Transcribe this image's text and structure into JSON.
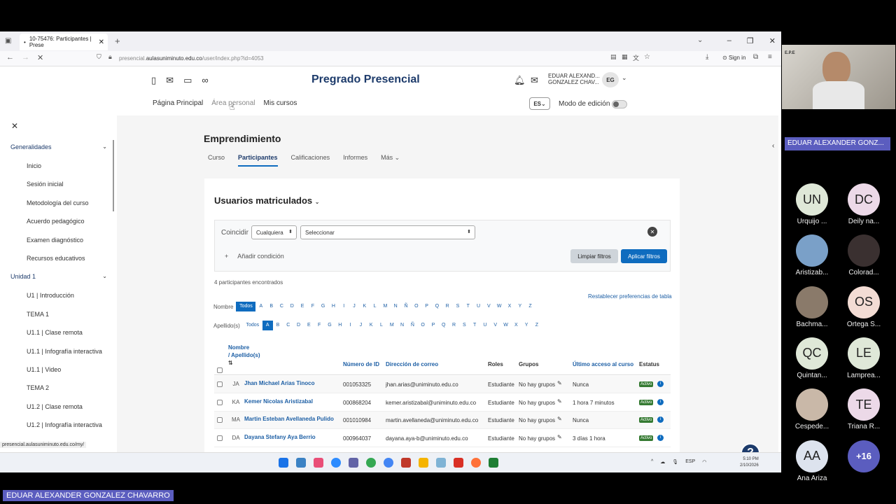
{
  "browser": {
    "tab_title": "10-75476: Participantes | Prese",
    "url_prefix": "presencial.",
    "url_domain": "aulasuniminuto.edu.co",
    "url_path": "/user/index.php?id=4053",
    "sign_in": "Sign in"
  },
  "site": {
    "brand": "Pregrado Presencial",
    "user_name_line1": "EDUAR ALEXAND...",
    "user_name_line2": "GONZALEZ CHAV...",
    "user_initials": "EG",
    "nav": [
      "Página Principal",
      "Área personal",
      "Mis cursos"
    ],
    "lang": "ES",
    "edit_mode": "Modo de edición"
  },
  "drawer": {
    "sections": [
      {
        "label": "Generalidades",
        "items": [
          "Inicio",
          "Sesión inicial",
          "Metodología del curso",
          "Acuerdo pedagógico",
          "Examen diagnóstico",
          "Recursos educativos"
        ]
      },
      {
        "label": "Unidad 1",
        "items": [
          "U1 | Introducción",
          "TEMA 1",
          "U1.1 | Clase remota",
          "U1.1 | Infografía interactiva",
          "U1.1 | Video",
          "TEMA 2",
          "U1.2 | Clase remota",
          "U1.2 | Infografía interactiva"
        ]
      }
    ]
  },
  "course": {
    "title": "Emprendimiento",
    "tabs": [
      "Curso",
      "Participantes",
      "Calificaciones",
      "Informes",
      "Más"
    ]
  },
  "participants": {
    "heading": "Usuarios matriculados",
    "filter_label": "Coincidir",
    "match_value": "Cualquiera",
    "select_value": "Seleccionar",
    "add_condition": "Añadir condición",
    "clear_filters": "Limpiar filtros",
    "apply_filters": "Aplicar filtros",
    "found": "4 participantes encontrados",
    "reset_prefs": "Restablecer preferencias de tabla",
    "first_name_label": "Nombre",
    "last_name_label": "Apellido(s)",
    "all_label": "Todos",
    "letters": [
      "A",
      "B",
      "C",
      "D",
      "E",
      "F",
      "G",
      "H",
      "I",
      "J",
      "K",
      "L",
      "M",
      "N",
      "Ñ",
      "O",
      "P",
      "Q",
      "R",
      "S",
      "T",
      "U",
      "V",
      "W",
      "X",
      "Y",
      "Z"
    ],
    "columns": {
      "name": "Nombre",
      "surname": "/ Apellido(s)",
      "id": "Número de ID",
      "email": "Dirección de correo",
      "roles": "Roles",
      "groups": "Grupos",
      "last_access": "Último acceso al curso",
      "status": "Estatus"
    },
    "rows": [
      {
        "initials": "JA",
        "name": "Jhan Michael Arias Tinoco",
        "id": "001053325",
        "email": "jhan.arias@uniminuto.edu.co",
        "role": "Estudiante",
        "groups": "No hay grupos",
        "last_access": "Nunca",
        "status": "Activo"
      },
      {
        "initials": "KA",
        "name": "Kemer Nicolas Aristizabal",
        "id": "000868204",
        "email": "kemer.aristizabal@uniminuto.edu.co",
        "role": "Estudiante",
        "groups": "No hay grupos",
        "last_access": "1 hora 7 minutos",
        "status": "Activo"
      },
      {
        "initials": "MA",
        "name": "Martin Esteban Avellaneda Pulido",
        "id": "001010984",
        "email": "martin.avellaneda@uniminuto.edu.co",
        "role": "Estudiante",
        "groups": "No hay grupos",
        "last_access": "Nunca",
        "status": "Activo"
      },
      {
        "initials": "DA",
        "name": "Dayana Stefany Aya Berrio",
        "id": "000964037",
        "email": "dayana.aya-b@uniminuto.edu.co",
        "role": "Estudiante",
        "groups": "No hay grupos",
        "last_access": "3 días 1 hora",
        "status": "Activo"
      }
    ]
  },
  "status_url": "presencial.aulasuniminuto.edu.co/my/",
  "taskbar": {
    "lang": "ESP",
    "time": "5:10 PM",
    "date": "2/10/2026"
  },
  "meeting": {
    "speaker": "EDUAR ALEXANDER GONZ...",
    "video_logo": "E.P.E",
    "bottom_name": "EDUAR ALEXANDER GONZALEZ CHAVARRO",
    "participants": [
      {
        "initials": "UN",
        "name": "Urquijo ...",
        "color": "#dfe8d8"
      },
      {
        "initials": "DC",
        "name": "Deily na...",
        "color": "#ecd9e8"
      },
      {
        "initials": "",
        "name": "Aristizab...",
        "color": "#7aa0c8"
      },
      {
        "initials": "",
        "name": "Colorad...",
        "color": "#3a3030"
      },
      {
        "initials": "",
        "name": "Bachma...",
        "color": "#8a7a6a"
      },
      {
        "initials": "OS",
        "name": "Ortega S...",
        "color": "#f3dcd4"
      },
      {
        "initials": "QC",
        "name": "Quintan...",
        "color": "#dfe8d8"
      },
      {
        "initials": "LE",
        "name": "Lamprea...",
        "color": "#dfe8d8"
      },
      {
        "initials": "",
        "name": "Cespede...",
        "color": "#c9b8a8"
      },
      {
        "initials": "TE",
        "name": "Triana R...",
        "color": "#ecd9e8"
      },
      {
        "initials": "AA",
        "name": "Ana Ariza",
        "color": "#dde3ee"
      },
      {
        "initials": "+16",
        "name": "",
        "color": "#5b5dbf"
      }
    ]
  }
}
